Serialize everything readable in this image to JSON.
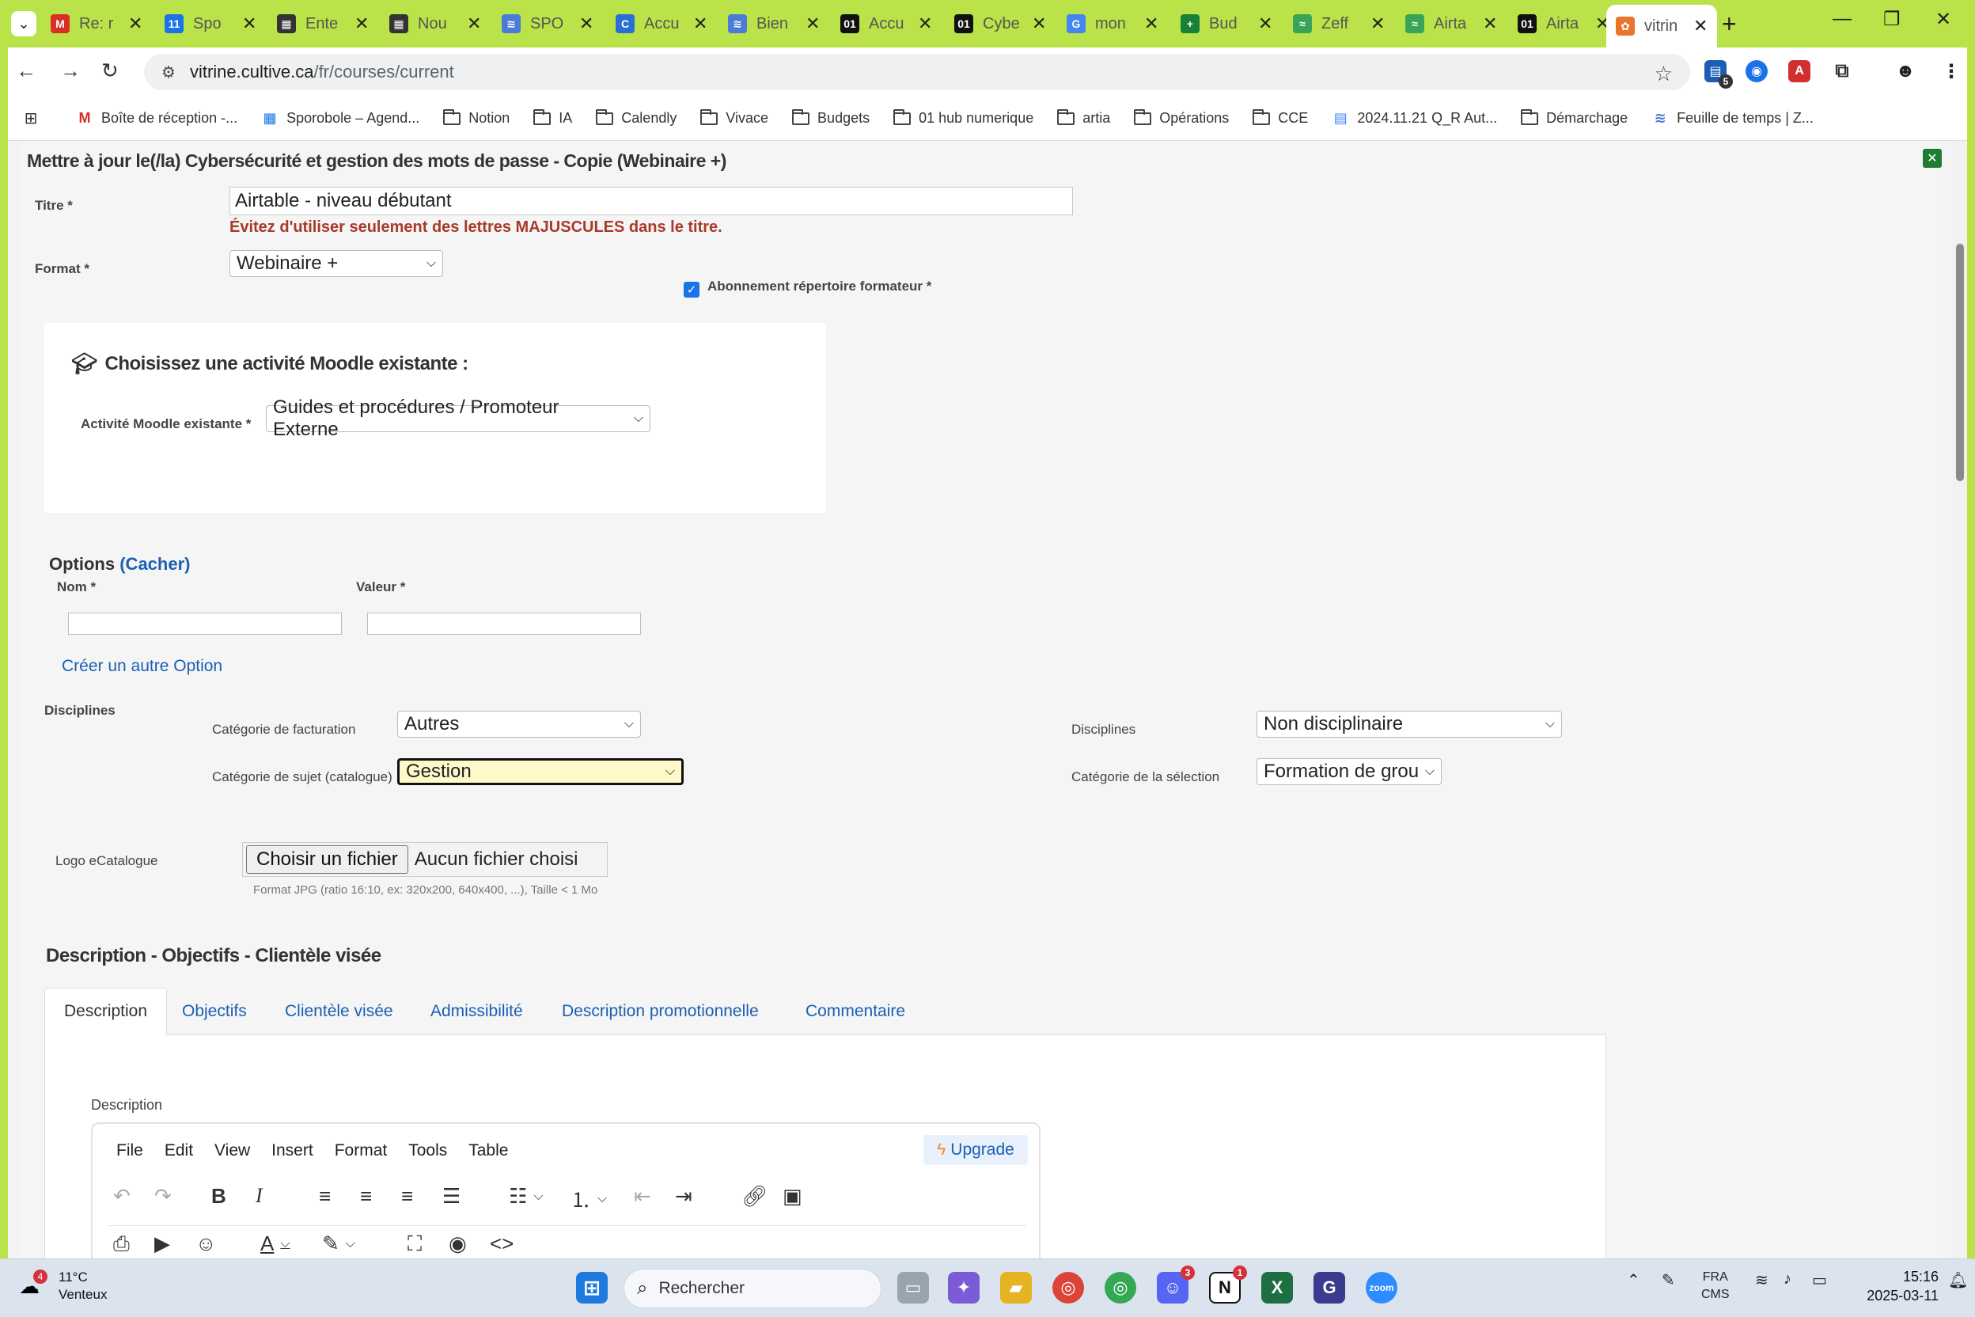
{
  "browser": {
    "tabs": [
      {
        "title": "Re: r",
        "icon": "gmail-icon",
        "color": "#d93025",
        "glyph": "M"
      },
      {
        "title": "Spo",
        "icon": "calendar-icon",
        "color": "#1a73e8",
        "glyph": "11"
      },
      {
        "title": "Ente",
        "icon": "clapper-icon",
        "color": "#333333",
        "glyph": "▦"
      },
      {
        "title": "Nou",
        "icon": "clapper-icon",
        "color": "#333333",
        "glyph": "▦"
      },
      {
        "title": "SPO",
        "icon": "zapier-icon",
        "color": "#4a7bd8",
        "glyph": "≋"
      },
      {
        "title": "Accu",
        "icon": "cultive-icon",
        "color": "#2a6fd6",
        "glyph": "C"
      },
      {
        "title": "Bien",
        "icon": "zapier-icon",
        "color": "#4a7bd8",
        "glyph": "≋"
      },
      {
        "title": "Accu",
        "icon": "one-icon",
        "color": "#111111",
        "glyph": "01"
      },
      {
        "title": "Cybe",
        "icon": "one-icon",
        "color": "#111111",
        "glyph": "01"
      },
      {
        "title": "mon",
        "icon": "google-icon",
        "color": "#4285f4",
        "glyph": "G"
      },
      {
        "title": "Bud",
        "icon": "sheets-icon",
        "color": "#188038",
        "glyph": "+"
      },
      {
        "title": "Zeff",
        "icon": "zeffy-icon",
        "color": "#3aa35a",
        "glyph": "≈"
      },
      {
        "title": "Airta",
        "icon": "zeffy-icon",
        "color": "#3aa35a",
        "glyph": "≈"
      },
      {
        "title": "Airta",
        "icon": "one-icon",
        "color": "#111111",
        "glyph": "01"
      },
      {
        "title": "vitrin",
        "icon": "vitrine-icon",
        "color": "#e8752a",
        "glyph": "✿"
      }
    ],
    "new_tab": "+",
    "url_host": "vitrine.cultive.ca",
    "url_path": "/fr/courses/current",
    "extension_badge": "5",
    "bookmarks": [
      {
        "label": "Boîte de réception -...",
        "icon": "gmail-icon"
      },
      {
        "label": "Sporobole – Agend...",
        "icon": "calendar-icon"
      },
      {
        "label": "Notion",
        "icon": "folder-icon"
      },
      {
        "label": "IA",
        "icon": "folder-icon"
      },
      {
        "label": "Calendly",
        "icon": "folder-icon"
      },
      {
        "label": "Vivace",
        "icon": "folder-icon"
      },
      {
        "label": "Budgets",
        "icon": "folder-icon"
      },
      {
        "label": "01 hub numerique",
        "icon": "folder-icon"
      },
      {
        "label": "artia",
        "icon": "folder-icon"
      },
      {
        "label": "Opérations",
        "icon": "folder-icon"
      },
      {
        "label": "CCE",
        "icon": "folder-icon"
      },
      {
        "label": "2024.11.21 Q_R Aut...",
        "icon": "docs-icon"
      },
      {
        "label": "Démarchage",
        "icon": "folder-icon"
      },
      {
        "label": "Feuille de temps | Z...",
        "icon": "zapier-icon"
      }
    ]
  },
  "page": {
    "title": "Mettre à jour le(/la) Cybersécurité et gestion des mots de passe - Copie (Webinaire +)",
    "titre_label": "Titre *",
    "titre_value": "Airtable - niveau débutant",
    "titre_warning": "Évitez d'utiliser seulement des lettres MAJUSCULES dans le titre.",
    "format_label": "Format *",
    "format_value": "Webinaire +",
    "abonnement_label": "Abonnement répertoire formateur *",
    "abonnement_checked": true,
    "moodle_heading": "Choisissez une activité Moodle existante :",
    "moodle_label": "Activité Moodle existante *",
    "moodle_value": "Guides et procédures / Promoteur Externe",
    "options_heading": "Options",
    "options_toggle": "(Cacher)",
    "nom_label": "Nom *",
    "valeur_label": "Valeur *",
    "create_option": "Créer un autre Option",
    "disciplines_heading": "Disciplines",
    "facturation_label": "Catégorie de facturation",
    "facturation_value": "Autres",
    "sujet_label": "Catégorie de sujet (catalogue)",
    "sujet_value": "Gestion",
    "disciplines_label": "Disciplines",
    "disciplines_value": "Non disciplinaire",
    "selection_label": "Catégorie de la sélection",
    "selection_value": "Formation de grou",
    "logo_label": "Logo eCatalogue",
    "file_button": "Choisir un fichier",
    "file_status": "Aucun fichier choisi",
    "file_hint": "Format JPG (ratio 16:10, ex: 320x200, 640x400, ...), Taille < 1 Mo",
    "desc_heading": "Description - Objectifs - Clientèle visée",
    "tabs": [
      "Description",
      "Objectifs",
      "Clientèle visée",
      "Admissibilité",
      "Description promotionnelle",
      "Commentaire"
    ],
    "editor_label": "Description",
    "editor_menu": [
      "File",
      "Edit",
      "View",
      "Insert",
      "Format",
      "Tools",
      "Table"
    ],
    "upgrade_label": "Upgrade"
  },
  "taskbar": {
    "weather_temp": "11°C",
    "weather_desc": "Venteux",
    "weather_badge": "4",
    "search_placeholder": "Rechercher",
    "discord_badge": "3",
    "notion_badge": "1",
    "lang": "FRA",
    "lang_sub": "CMS",
    "time": "15:16",
    "date": "2025-03-11"
  },
  "colors": {
    "frame": "#b9e349",
    "link": "#1a5fb4",
    "warning": "#a83a2a",
    "focus_select": "#fff8c8"
  }
}
